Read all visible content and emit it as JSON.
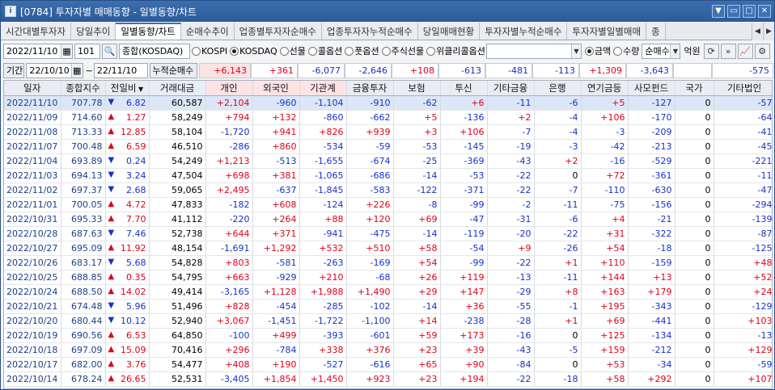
{
  "window": {
    "title": "[0784] 투자자별 매매동향 - 일별동향/차트",
    "icon": "window-app-icon"
  },
  "tabs": [
    "시간대별투자자",
    "당일추이",
    "일별동향/차트",
    "순매수추이",
    "업종별투자자순매수",
    "업종투자자누적순매수",
    "당일매매현황",
    "투자자별누적순매수",
    "투자자별일별매매",
    "종"
  ],
  "active_tab": 2,
  "toolbar": {
    "date": "2022/11/10",
    "market_code": "101",
    "market_name": "종합(KOSDAQ)",
    "markets": [
      "KOSPI",
      "KOSDAQ",
      "선물",
      "콜옵션",
      "풋옵션",
      "주식선물",
      "위클리콜옵션"
    ],
    "market_selected": 1,
    "unit_options": [
      "금액",
      "수량"
    ],
    "unit_selected": 0,
    "mode": "순매수",
    "unit_label": "억원"
  },
  "period": {
    "label": "기간",
    "from": "22/10/10",
    "to": "22/11/10",
    "sum_label": "누적순매수",
    "sums": [
      "+6,143",
      "+361",
      "-6,077",
      "-2,646",
      "+108",
      "-613",
      "-481",
      "-113",
      "+1,309",
      "-3,643",
      "",
      "-575"
    ]
  },
  "columns": [
    "일자",
    "종합지수",
    "전일비",
    "거래대금",
    "개인",
    "외국인",
    "기관계",
    "금융투자",
    "보험",
    "투신",
    "기타금융",
    "은행",
    "연기금등",
    "사모펀드",
    "국가",
    "기타법인"
  ],
  "rows": [
    [
      "2022/11/10",
      "707.78",
      "dn",
      "6.82",
      "60,587",
      "+2,104",
      "-960",
      "-1,104",
      "-910",
      "-62",
      "+6",
      "-11",
      "-6",
      "+5",
      "-127",
      "0",
      "-57"
    ],
    [
      "2022/11/09",
      "714.60",
      "up",
      "1.27",
      "58,249",
      "+794",
      "+132",
      "-860",
      "-662",
      "+5",
      "-136",
      "+2",
      "-4",
      "+106",
      "-170",
      "0",
      "-64"
    ],
    [
      "2022/11/08",
      "713.33",
      "up",
      "12.85",
      "58,104",
      "-1,720",
      "+941",
      "+826",
      "+939",
      "+3",
      "+106",
      "-7",
      "-4",
      "-3",
      "-209",
      "0",
      "-41"
    ],
    [
      "2022/11/07",
      "700.48",
      "up",
      "6.59",
      "46,510",
      "-286",
      "+860",
      "-534",
      "-59",
      "-53",
      "-145",
      "-19",
      "-3",
      "-42",
      "-213",
      "0",
      "-45"
    ],
    [
      "2022/11/04",
      "693.89",
      "dn",
      "0.24",
      "54,249",
      "+1,213",
      "-513",
      "-1,655",
      "-674",
      "-25",
      "-369",
      "-43",
      "+2",
      "-16",
      "-529",
      "0",
      "-221"
    ],
    [
      "2022/11/03",
      "694.13",
      "dn",
      "3.24",
      "47,504",
      "+698",
      "+381",
      "-1,065",
      "-686",
      "-14",
      "-53",
      "-22",
      "0",
      "+72",
      "-361",
      "0",
      "-11"
    ],
    [
      "2022/11/02",
      "697.37",
      "dn",
      "2.68",
      "59,065",
      "+2,495",
      "-637",
      "-1,845",
      "-583",
      "-122",
      "-371",
      "-22",
      "-7",
      "-110",
      "-630",
      "0",
      "-47"
    ],
    [
      "2022/11/01",
      "700.05",
      "up",
      "4.72",
      "47,833",
      "-182",
      "+608",
      "-124",
      "+226",
      "-8",
      "-99",
      "-2",
      "-11",
      "-75",
      "-156",
      "0",
      "-294"
    ],
    [
      "2022/10/31",
      "695.33",
      "up",
      "7.70",
      "41,112",
      "-220",
      "+264",
      "+88",
      "+120",
      "+69",
      "-47",
      "-31",
      "-6",
      "+4",
      "-21",
      "0",
      "-139"
    ],
    [
      "2022/10/28",
      "687.63",
      "dn",
      "7.46",
      "52,738",
      "+644",
      "+371",
      "-941",
      "-475",
      "-14",
      "-119",
      "-20",
      "-22",
      "+31",
      "-322",
      "0",
      "-87"
    ],
    [
      "2022/10/27",
      "695.09",
      "up",
      "11.92",
      "48,154",
      "-1,691",
      "+1,292",
      "+532",
      "+510",
      "+58",
      "-54",
      "+9",
      "-26",
      "+54",
      "-18",
      "0",
      "-125"
    ],
    [
      "2022/10/26",
      "683.17",
      "dn",
      "5.68",
      "54,828",
      "+803",
      "-581",
      "-263",
      "-169",
      "+54",
      "-99",
      "-22",
      "+1",
      "+110",
      "-159",
      "0",
      "+48"
    ],
    [
      "2022/10/25",
      "688.85",
      "up",
      "0.35",
      "54,795",
      "+663",
      "-929",
      "+210",
      "-68",
      "+26",
      "+119",
      "-13",
      "-11",
      "+144",
      "+13",
      "0",
      "+52"
    ],
    [
      "2022/10/24",
      "688.50",
      "up",
      "14.02",
      "49,414",
      "-3,165",
      "+1,128",
      "+1,988",
      "+1,490",
      "+29",
      "+147",
      "-29",
      "+8",
      "+163",
      "+179",
      "0",
      "+24"
    ],
    [
      "2022/10/21",
      "674.48",
      "dn",
      "5.96",
      "51,496",
      "+828",
      "-454",
      "-285",
      "-102",
      "-14",
      "+36",
      "-55",
      "-1",
      "+195",
      "-343",
      "0",
      "-129"
    ],
    [
      "2022/10/20",
      "680.44",
      "dn",
      "10.12",
      "52,940",
      "+3,067",
      "-1,451",
      "-1,722",
      "-1,100",
      "+14",
      "-238",
      "-28",
      "+1",
      "+69",
      "-441",
      "0",
      "+103"
    ],
    [
      "2022/10/19",
      "690.56",
      "up",
      "6.53",
      "64,850",
      "-100",
      "+499",
      "-393",
      "-601",
      "+59",
      "+173",
      "-16",
      "0",
      "+125",
      "-134",
      "0",
      "-13"
    ],
    [
      "2022/10/18",
      "697.09",
      "up",
      "15.09",
      "70,416",
      "+296",
      "-784",
      "+338",
      "+376",
      "+23",
      "+39",
      "-43",
      "-5",
      "+159",
      "-212",
      "0",
      "+129"
    ],
    [
      "2022/10/17",
      "682.00",
      "up",
      "3.76",
      "54,477",
      "+408",
      "+190",
      "-527",
      "-616",
      "+65",
      "+90",
      "-84",
      "0",
      "+53",
      "-34",
      "0",
      "-59"
    ],
    [
      "2022/10/14",
      "678.24",
      "up",
      "26.65",
      "52,531",
      "-3,405",
      "+1,854",
      "+1,450",
      "+923",
      "+23",
      "+194",
      "-22",
      "-18",
      "+58",
      "+292",
      "0",
      "+107"
    ]
  ],
  "colors": {
    "up": "#e0001a",
    "down": "#1532c8",
    "header": "#e9edf3",
    "pink_header": "#fde3e3",
    "title_bar": "#2c5a98"
  }
}
